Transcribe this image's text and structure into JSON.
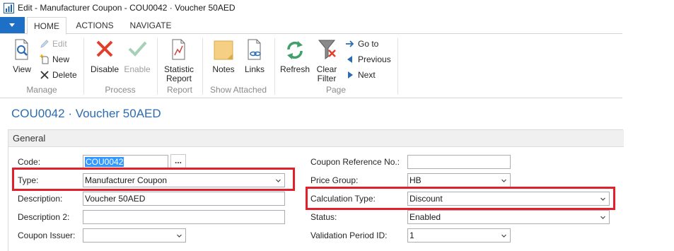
{
  "window": {
    "title": "Edit - Manufacturer Coupon - COU0042 · Voucher 50AED"
  },
  "ribbon_tabs": [
    {
      "label": "HOME",
      "active": true
    },
    {
      "label": "ACTIONS",
      "active": false
    },
    {
      "label": "NAVIGATE",
      "active": false
    }
  ],
  "ribbon": {
    "groups": {
      "manage": "Manage",
      "process": "Process",
      "report": "Report",
      "show_attached": "Show Attached",
      "page": "Page"
    },
    "buttons": {
      "view": "View",
      "edit": "Edit",
      "new": "New",
      "delete": "Delete",
      "disable": "Disable",
      "enable": "Enable",
      "statistic_line1": "Statistic",
      "statistic_line2": "Report",
      "notes": "Notes",
      "links": "Links",
      "refresh": "Refresh",
      "clear_filter_line1": "Clear",
      "clear_filter_line2": "Filter",
      "go_to": "Go to",
      "previous": "Previous",
      "next": "Next"
    }
  },
  "page_title": "COU0042 · Voucher 50AED",
  "general": {
    "header": "General",
    "left_fields": [
      {
        "label": "Code:",
        "value": "COU0042"
      },
      {
        "label": "Type:",
        "value": "Manufacturer Coupon"
      },
      {
        "label": "Description:",
        "value": "Voucher 50AED"
      },
      {
        "label": "Description 2:",
        "value": ""
      },
      {
        "label": "Coupon Issuer:",
        "value": ""
      }
    ],
    "right_fields": [
      {
        "label": "Coupon Reference No.:",
        "value": ""
      },
      {
        "label": "Price Group:",
        "value": "HB"
      },
      {
        "label": "Calculation Type:",
        "value": "Discount"
      },
      {
        "label": "Status:",
        "value": "Enabled"
      },
      {
        "label": "Validation Period ID:",
        "value": "1"
      }
    ],
    "lookup_button": "..."
  },
  "colors": {
    "accent": "#1e6fc6",
    "title": "#2b6cb0",
    "highlight": "#e0202a",
    "disabled": "#a0a0a0"
  }
}
